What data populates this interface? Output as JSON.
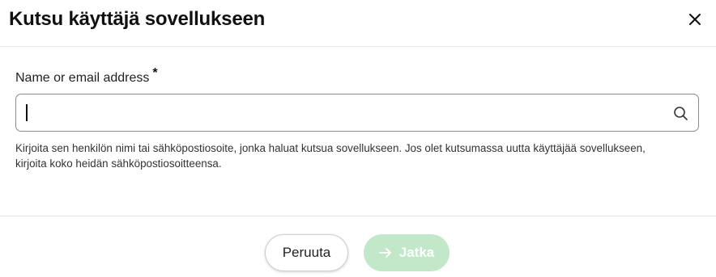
{
  "dialog": {
    "title": "Kutsu käyttäjä sovellukseen",
    "close_icon": "close-icon"
  },
  "field": {
    "label": "Name or email address",
    "required_mark": "*",
    "value": "",
    "search_icon": "search-icon",
    "help_text": "Kirjoita sen henkilön nimi tai sähköpostiosoite, jonka haluat kutsua sovellukseen. Jos olet kutsumassa uutta käyttäjää sovellukseen, kirjoita koko heidän sähköpostiosoitteensa."
  },
  "footer": {
    "cancel_label": "Peruuta",
    "continue_label": "Jatka",
    "continue_icon": "arrow-right-icon",
    "continue_disabled": true
  },
  "colors": {
    "continue_bg": "#c3e8c9",
    "input_border": "#8a8a8a",
    "divider": "#e6e6e6"
  }
}
